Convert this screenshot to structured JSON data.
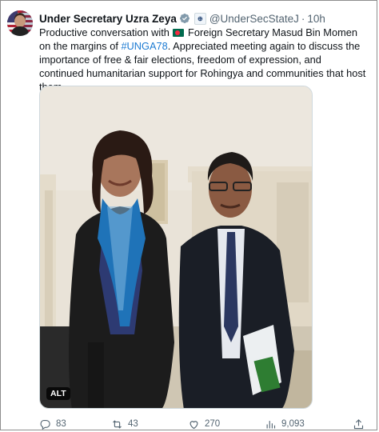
{
  "tweet": {
    "author_name": "Under Secretary Uzra Zeya",
    "handle": "@UnderSecStateJ",
    "separator": "·",
    "time": "10h",
    "org_badge_text": "⊕",
    "text_part1": "Productive conversation with ",
    "text_part2": " Foreign Secretary Masud Bin Momen on the margins of ",
    "hashtag": "#UNGA78",
    "text_part3": ". Appreciated meeting again to discuss the importance of free & fair elections, freedom of expression, and continued humanitarian support for Rohingya and communities that host them.",
    "flag_icon": "bangladesh-flag",
    "media_alt_label": "ALT"
  },
  "actions": {
    "replies": "83",
    "retweets": "43",
    "likes": "270",
    "views": "9,093"
  },
  "colors": {
    "link": "#1d7bd2",
    "verified": "#1d9bf0",
    "muted": "#536471"
  }
}
